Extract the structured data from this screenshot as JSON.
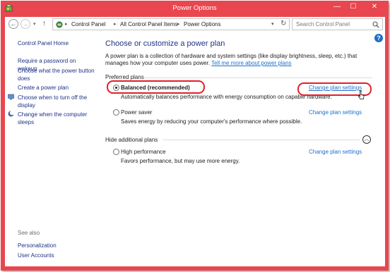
{
  "window": {
    "title": "Power Options",
    "minimize_glyph": "—",
    "maximize_glyph": "☐",
    "close_glyph": "✕",
    "accent_color": "#e9464f"
  },
  "address_bar": {
    "breadcrumbs": [
      "Control Panel",
      "All Control Panel Items",
      "Power Options"
    ],
    "search_placeholder": "Search Control Panel"
  },
  "sidebar": {
    "home": "Control Panel Home",
    "links": [
      "Require a password on wakeup",
      "Choose what the power button does",
      "Create a power plan",
      "Choose when to turn off the display",
      "Change when the computer sleeps"
    ],
    "see_also_label": "See also",
    "see_also_links": [
      "Personalization",
      "User Accounts"
    ]
  },
  "main": {
    "heading": "Choose or customize a power plan",
    "description": "A power plan is a collection of hardware and system settings (like display brightness, sleep, etc.) that manages how your computer uses power.",
    "learn_more_link": "Tell me more about power plans",
    "preferred_plans_label": "Preferred plans",
    "hide_additional_label": "Hide additional plans",
    "change_plan_label": "Change plan settings",
    "plans": [
      {
        "name": "Balanced (recommended)",
        "description": "Automatically balances performance with energy consumption on capable hardware.",
        "selected": true
      },
      {
        "name": "Power saver",
        "description": "Saves energy by reducing your computer's performance where possible.",
        "selected": false
      },
      {
        "name": "High performance",
        "description": "Favors performance, but may use more energy.",
        "selected": false
      }
    ],
    "highlight_color": "#e0202a"
  }
}
